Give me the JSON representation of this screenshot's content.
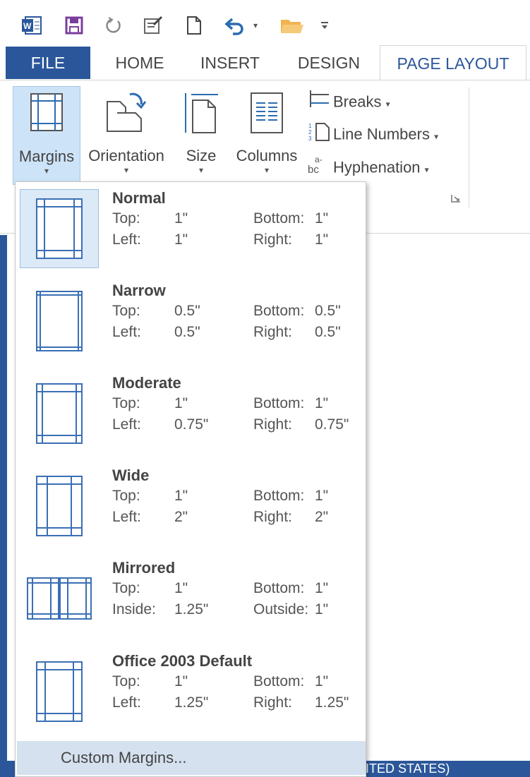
{
  "quick_access": {
    "icons": [
      "word-logo-icon",
      "save-icon",
      "redo-icon",
      "edit-doc-icon",
      "new-doc-icon",
      "undo-icon",
      "open-folder-icon",
      "customize-toolbar-icon"
    ]
  },
  "tabs": [
    {
      "label": "FILE"
    },
    {
      "label": "HOME"
    },
    {
      "label": "INSERT"
    },
    {
      "label": "DESIGN"
    },
    {
      "label": "PAGE LAYOUT"
    }
  ],
  "ribbon": {
    "margins": "Margins",
    "orientation": "Orientation",
    "size": "Size",
    "columns": "Columns",
    "breaks": "Breaks",
    "line_numbers": "Line Numbers",
    "hyphenation": "Hyphenation",
    "caret": "▾"
  },
  "margins_menu": {
    "items": [
      {
        "name": "Normal",
        "a_label": "Top:",
        "a_val": "1\"",
        "b_label": "Bottom:",
        "b_val": "1\"",
        "c_label": "Left:",
        "c_val": "1\"",
        "d_label": "Right:",
        "d_val": "1\""
      },
      {
        "name": "Narrow",
        "a_label": "Top:",
        "a_val": "0.5\"",
        "b_label": "Bottom:",
        "b_val": "0.5\"",
        "c_label": "Left:",
        "c_val": "0.5\"",
        "d_label": "Right:",
        "d_val": "0.5\""
      },
      {
        "name": "Moderate",
        "a_label": "Top:",
        "a_val": "1\"",
        "b_label": "Bottom:",
        "b_val": "1\"",
        "c_label": "Left:",
        "c_val": "0.75\"",
        "d_label": "Right:",
        "d_val": "0.75\""
      },
      {
        "name": "Wide",
        "a_label": "Top:",
        "a_val": "1\"",
        "b_label": "Bottom:",
        "b_val": "1\"",
        "c_label": "Left:",
        "c_val": "2\"",
        "d_label": "Right:",
        "d_val": "2\""
      },
      {
        "name": "Mirrored",
        "a_label": "Top:",
        "a_val": "1\"",
        "b_label": "Bottom:",
        "b_val": "1\"",
        "c_label": "Inside:",
        "c_val": "1.25\"",
        "d_label": "Outside:",
        "d_val": "1\""
      },
      {
        "name": "Office 2003 Default",
        "a_label": "Top:",
        "a_val": "1\"",
        "b_label": "Bottom:",
        "b_val": "1\"",
        "c_label": "Left:",
        "c_val": "1.25\"",
        "d_label": "Right:",
        "d_val": "1.25\""
      }
    ],
    "custom": "Custom Margins..."
  },
  "status_bar": {
    "text": "ITED STATES)"
  },
  "colors": {
    "accent": "#2b579a",
    "selected_bg": "#cde3f7",
    "custom_bg": "#d5e1ef",
    "thumb_line": "#2b6cb0"
  }
}
